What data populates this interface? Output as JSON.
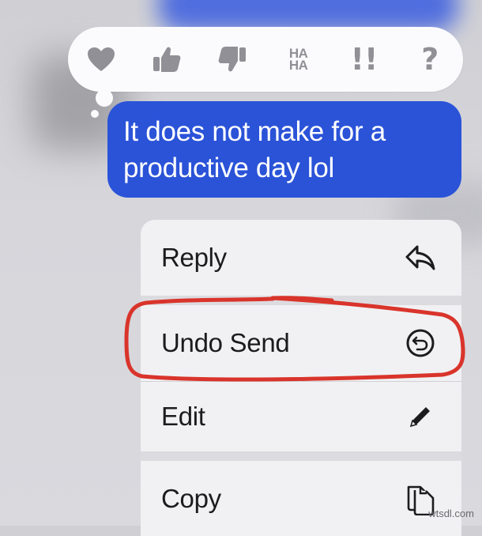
{
  "tapbacks": [
    {
      "name": "heart"
    },
    {
      "name": "thumbs-up"
    },
    {
      "name": "thumbs-down"
    },
    {
      "name": "haha",
      "label_top": "HA",
      "label_bottom": "HA"
    },
    {
      "name": "exclamation",
      "label": "!!"
    },
    {
      "name": "question",
      "label": "?"
    }
  ],
  "message": {
    "line1": "It does not make for a",
    "line2": "productive day lol",
    "bubble_color": "#2a53d8"
  },
  "menu": {
    "items": [
      {
        "label": "Reply",
        "icon": "reply-arrow-icon"
      },
      {
        "label": "Undo Send",
        "icon": "undo-send-icon",
        "highlighted": true
      },
      {
        "label": "Edit",
        "icon": "pencil-icon"
      },
      {
        "label": "Copy",
        "icon": "copy-icon"
      }
    ]
  },
  "annotation_color": "#d9342b",
  "watermark": "wtsdl.com"
}
